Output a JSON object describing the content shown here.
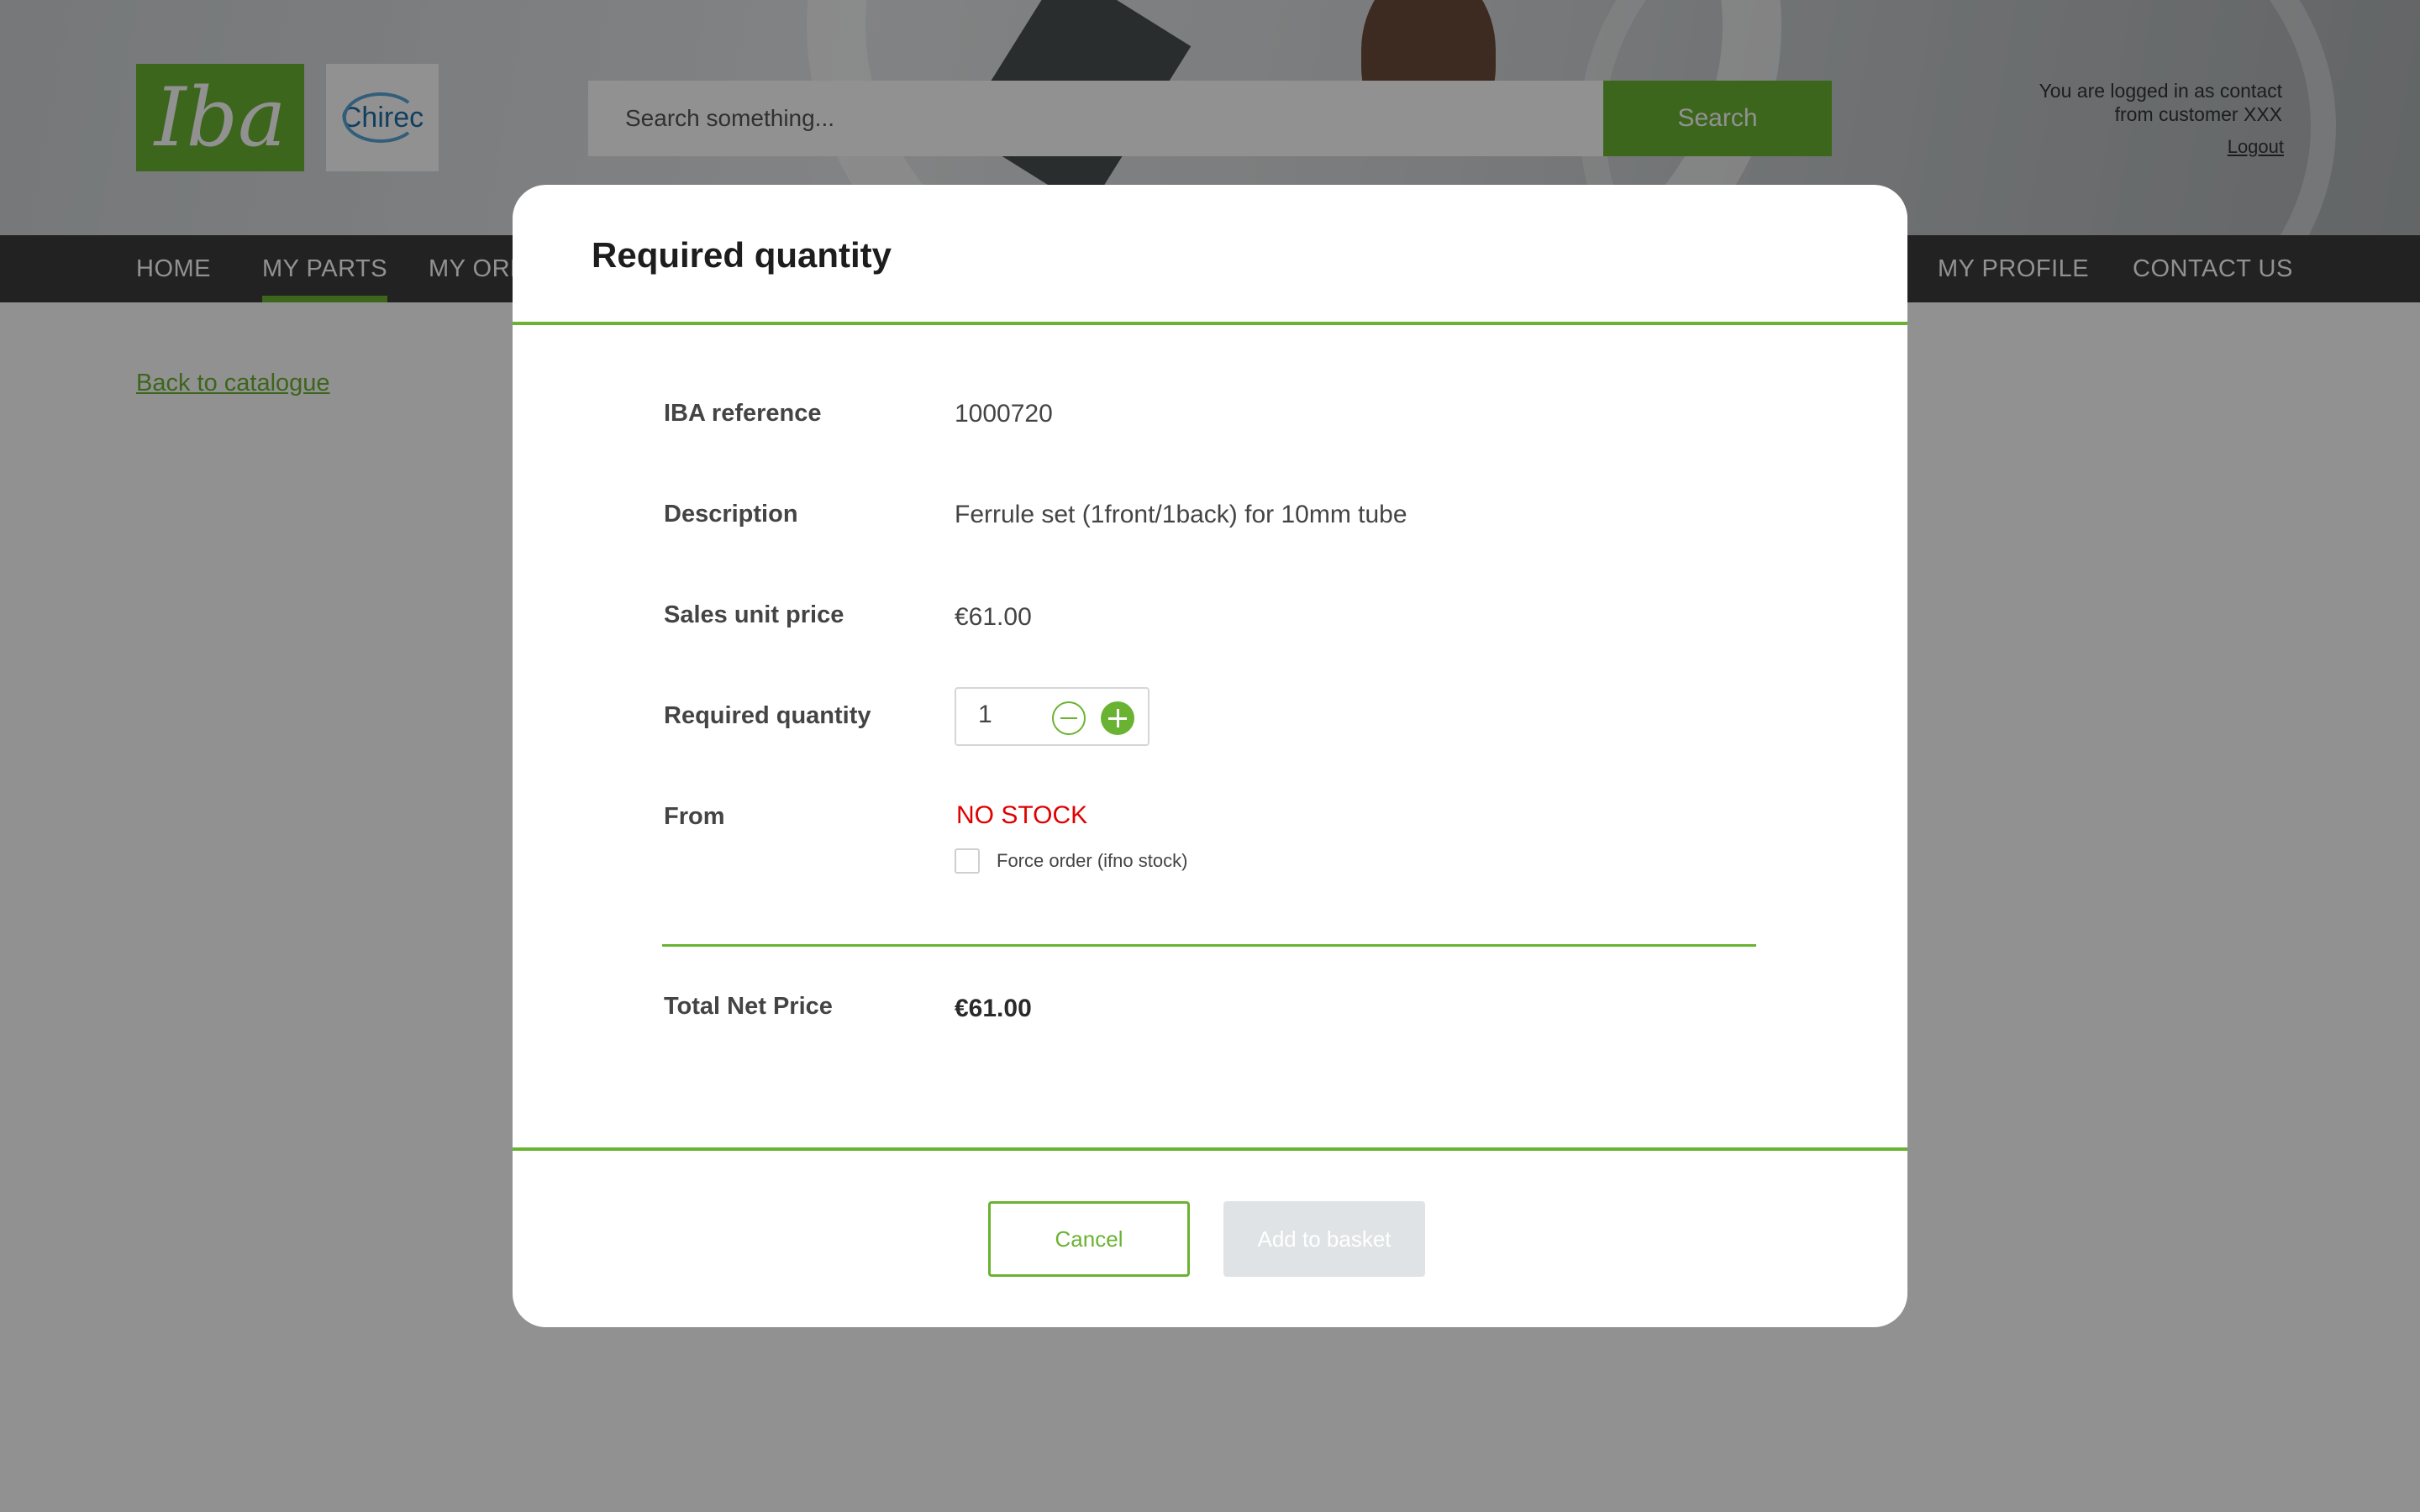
{
  "header": {
    "logo_text": "Iba",
    "partner_logo_text": "Chirec",
    "search": {
      "placeholder": "Search something...",
      "button_label": "Search"
    },
    "login_line1": "You are logged in as contact",
    "login_line2": "from customer XXX",
    "logout_label": "Logout"
  },
  "nav": {
    "items": [
      {
        "label": "HOME"
      },
      {
        "label": "MY PARTS"
      },
      {
        "label": "MY ORDERS"
      },
      {
        "label": "MY PROFILE"
      },
      {
        "label": "CONTACT US"
      }
    ],
    "active": "MY PARTS"
  },
  "page": {
    "back_link": "Back to catalogue"
  },
  "modal": {
    "title": "Required quantity",
    "fields": {
      "reference": {
        "label": "IBA reference",
        "value": "1000720"
      },
      "description": {
        "label": "Description",
        "value": "Ferrule set (1front/1back) for 10mm tube"
      },
      "unit_price": {
        "label": "Sales unit price",
        "value": "€61.00"
      },
      "quantity": {
        "label": "Required quantity",
        "value": "1"
      },
      "from": {
        "label": "From",
        "value": "NO STOCK"
      }
    },
    "force_order": {
      "label": "Force order (ifno stock)",
      "checked": false
    },
    "total": {
      "label": "Total Net Price",
      "value": "€61.00"
    },
    "buttons": {
      "cancel": "Cancel",
      "add": "Add to basket"
    }
  },
  "colors": {
    "brand_green": "#6ab332",
    "nav_bg": "#3c3c3c",
    "stock_red": "#e00000",
    "disabled_btn": "#dfe3e6"
  }
}
